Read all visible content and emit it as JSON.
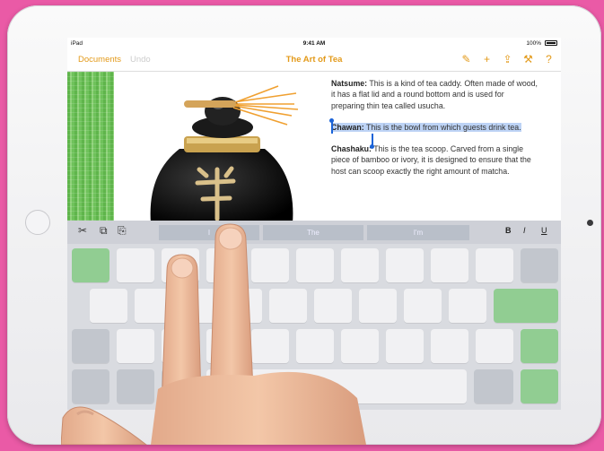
{
  "status_bar": {
    "device": "iPad",
    "time": "9:41 AM",
    "battery": "100%"
  },
  "nav": {
    "documents": "Documents",
    "undo": "Undo",
    "title": "The Art of Tea",
    "icons": [
      "format-brush-icon",
      "add-icon",
      "share-icon",
      "wrench-icon",
      "help-icon"
    ],
    "icon_glyphs": {
      "brush": "✎",
      "add": "+",
      "share": "⇪",
      "wrench": "⚒",
      "help": "?"
    }
  },
  "document": {
    "natsume_term": "Natsume:",
    "natsume_text": " This is a kind of tea caddy. Often made of wood, it has a flat lid and a round bottom and is used for preparing thin tea called usucha.",
    "chawan_term": "Chawan:",
    "chawan_text": " This is the bowl from which guests drink tea.",
    "chashaku_term": "Chashaku:",
    "chashaku_text": " This is the tea scoop. Carved from a single piece of bamboo or ivory, it is designed to ensure that the host can scoop exactly the right amount of matcha."
  },
  "keyboard": {
    "shortcut_icons": {
      "cut": "✂",
      "copy": "⧉",
      "paste": "⎘"
    },
    "predictions": [
      "I",
      "The",
      "I'm"
    ],
    "format": {
      "bold": "B",
      "italic": "I",
      "underline": "U"
    }
  },
  "colors": {
    "accent": "#e39a1a",
    "selection": "#bdd3f5",
    "cursor": "#1a63d8",
    "background": "#ea5aa6"
  }
}
